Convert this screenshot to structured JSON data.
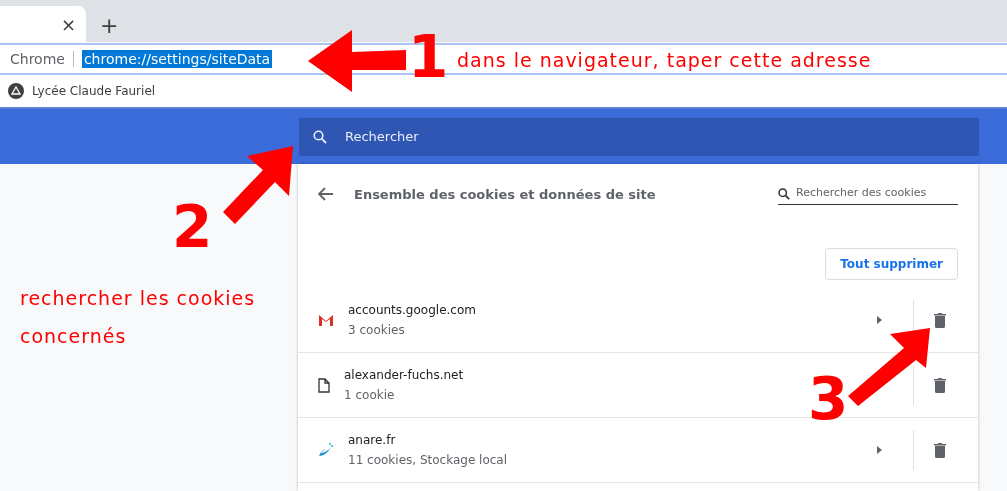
{
  "browser": {
    "new_tab": "+",
    "close_tab": "×",
    "address_label": "Chrome",
    "address": "chrome://settings/siteData",
    "address_selected": true,
    "bookmark": "Lycée Claude Fauriel"
  },
  "settings_search": {
    "placeholder": "Rechercher"
  },
  "panel": {
    "title": "Ensemble des cookies et données de site",
    "search_placeholder": "Rechercher des cookies",
    "remove_all": "Tout supprimer",
    "sites": [
      {
        "name": "accounts.google.com",
        "detail": "3 cookies",
        "kind": "mail",
        "expandable": true
      },
      {
        "name": "alexander-fuchs.net",
        "detail": "1 cookie",
        "kind": "file",
        "expandable": false
      },
      {
        "name": "anare.fr",
        "detail": "11 cookies, Stockage local",
        "kind": "bird",
        "expandable": true
      }
    ]
  },
  "annotations": [
    {
      "number": "1",
      "text": "dans le navigateur, taper cette adresse"
    },
    {
      "number": "2",
      "text": "rechercher les cookies concernés"
    },
    {
      "number": "3"
    }
  ]
}
